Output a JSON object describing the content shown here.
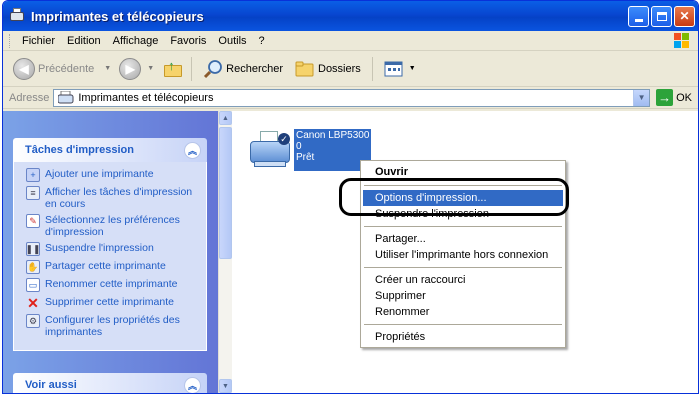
{
  "window": {
    "title": "Imprimantes et télécopieurs"
  },
  "menubar": {
    "items": [
      "Fichier",
      "Edition",
      "Affichage",
      "Favoris",
      "Outils",
      "?"
    ]
  },
  "toolbar": {
    "back_label": "Précédente",
    "search_label": "Rechercher",
    "folders_label": "Dossiers"
  },
  "address": {
    "label": "Adresse",
    "value": "Imprimantes et télécopieurs",
    "go_label": "OK"
  },
  "sidebar": {
    "print_tasks_title": "Tâches d'impression",
    "tasks": [
      {
        "label": "Ajouter une imprimante",
        "icon": "add-printer-icon"
      },
      {
        "label": "Afficher les tâches d'impression en cours",
        "icon": "print-queue-icon"
      },
      {
        "label": "Sélectionnez les préférences d'impression",
        "icon": "preferences-icon"
      },
      {
        "label": "Suspendre l'impression",
        "icon": "pause-printer-icon"
      },
      {
        "label": "Partager cette imprimante",
        "icon": "share-printer-icon"
      },
      {
        "label": "Renommer cette imprimante",
        "icon": "rename-icon"
      },
      {
        "label": "Supprimer cette imprimante",
        "icon": "delete-icon"
      },
      {
        "label": "Configurer les propriétés des imprimantes",
        "icon": "properties-icon"
      }
    ],
    "see_also_title": "Voir aussi"
  },
  "printer": {
    "name": "Canon LBP5300",
    "count": "0",
    "status": "Prêt"
  },
  "context_menu": {
    "items": [
      {
        "label": "Ouvrir",
        "bold": true
      },
      {
        "separator": true
      },
      {
        "label": "Options d'impression...",
        "selected": true
      },
      {
        "label": "Suspendre l'impression"
      },
      {
        "separator": true
      },
      {
        "label": "Partager..."
      },
      {
        "label": "Utiliser l'imprimante hors connexion"
      },
      {
        "separator": true
      },
      {
        "label": "Créer un raccourci"
      },
      {
        "label": "Supprimer"
      },
      {
        "label": "Renommer"
      },
      {
        "separator": true
      },
      {
        "label": "Propriétés"
      }
    ]
  },
  "colors": {
    "titlebar": "#0a54e0",
    "selection": "#316ac5",
    "task_link": "#215dc6"
  }
}
